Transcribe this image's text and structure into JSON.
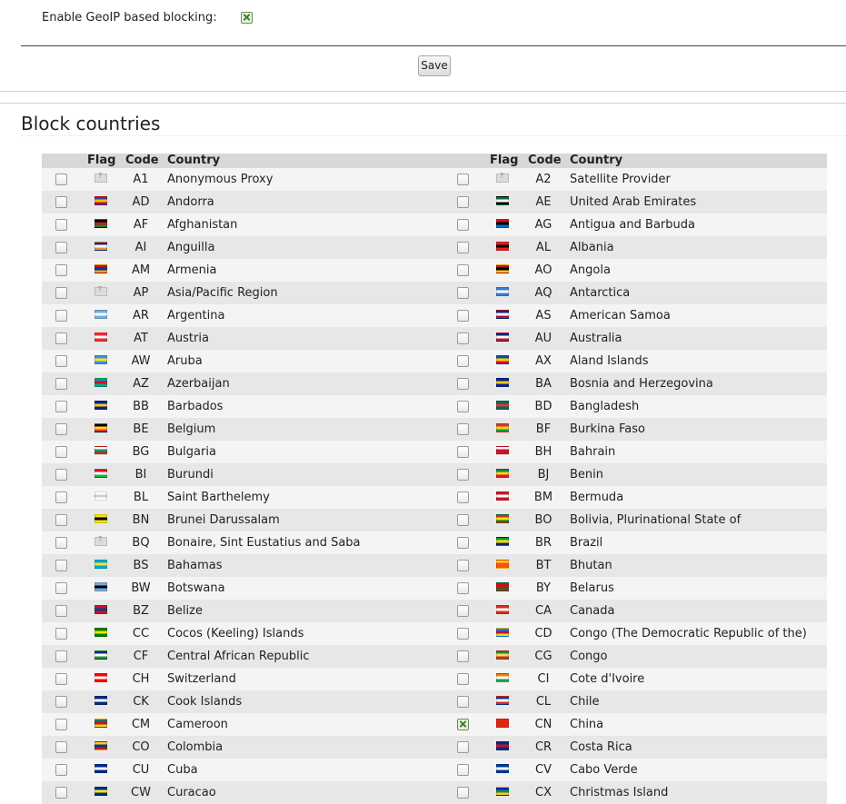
{
  "settings": {
    "geoip_label": "Enable GeoIP based blocking:",
    "geoip_checked": true,
    "save_label": "Save"
  },
  "section_title": "Block countries",
  "headers": {
    "flag": "Flag",
    "code": "Code",
    "country": "Country"
  },
  "rows": [
    {
      "left": {
        "code": "A1",
        "name": "Anonymous Proxy",
        "flag": [
          "unknown"
        ],
        "checked": false
      },
      "right": {
        "code": "A2",
        "name": "Satellite Provider",
        "flag": [
          "unknown"
        ],
        "checked": false
      }
    },
    {
      "left": {
        "code": "AD",
        "name": "Andorra",
        "flag": [
          "#2c3f9e",
          "#f2c300",
          "#d1001f"
        ],
        "checked": false
      },
      "right": {
        "code": "AE",
        "name": "United Arab Emirates",
        "flag": [
          "#00732f",
          "#ffffff",
          "#000000"
        ],
        "checked": false
      }
    },
    {
      "left": {
        "code": "AF",
        "name": "Afghanistan",
        "flag": [
          "#000000",
          "#b32121",
          "#2a7a2a"
        ],
        "checked": false
      },
      "right": {
        "code": "AG",
        "name": "Antigua and Barbuda",
        "flag": [
          "#ce1126",
          "#000000",
          "#0072c6"
        ],
        "checked": false
      }
    },
    {
      "left": {
        "code": "AI",
        "name": "Anguilla",
        "flag": [
          "#1c2a8c",
          "#ffffff",
          "#ef8d2f"
        ],
        "checked": false
      },
      "right": {
        "code": "AL",
        "name": "Albania",
        "flag": [
          "#e41e20",
          "#000000",
          "#e41e20"
        ],
        "checked": false
      }
    },
    {
      "left": {
        "code": "AM",
        "name": "Armenia",
        "flag": [
          "#d90012",
          "#0033a0",
          "#f2a800"
        ],
        "checked": false
      },
      "right": {
        "code": "AO",
        "name": "Angola",
        "flag": [
          "#cc092f",
          "#000000",
          "#ffcb00"
        ],
        "checked": false
      }
    },
    {
      "left": {
        "code": "AP",
        "name": "Asia/Pacific Region",
        "flag": [
          "unknown"
        ],
        "checked": false
      },
      "right": {
        "code": "AQ",
        "name": "Antarctica",
        "flag": [
          "#3a7dce",
          "#ffffff",
          "#3a7dce"
        ],
        "checked": false
      }
    },
    {
      "left": {
        "code": "AR",
        "name": "Argentina",
        "flag": [
          "#74acdf",
          "#ffffff",
          "#74acdf"
        ],
        "checked": false
      },
      "right": {
        "code": "AS",
        "name": "American Samoa",
        "flag": [
          "#002b7f",
          "#ffffff",
          "#bf0a30"
        ],
        "checked": false
      }
    },
    {
      "left": {
        "code": "AT",
        "name": "Austria",
        "flag": [
          "#ed2939",
          "#ffffff",
          "#ed2939"
        ],
        "checked": false
      },
      "right": {
        "code": "AU",
        "name": "Australia",
        "flag": [
          "#00247d",
          "#ffffff",
          "#cf142b"
        ],
        "checked": false
      }
    },
    {
      "left": {
        "code": "AW",
        "name": "Aruba",
        "flag": [
          "#418fde",
          "#f9e814",
          "#418fde"
        ],
        "checked": false
      },
      "right": {
        "code": "AX",
        "name": "Aland Islands",
        "flag": [
          "#0053a5",
          "#ffce00",
          "#d21034"
        ],
        "checked": false
      }
    },
    {
      "left": {
        "code": "AZ",
        "name": "Azerbaijan",
        "flag": [
          "#0092bc",
          "#e4002b",
          "#00af66"
        ],
        "checked": false
      },
      "right": {
        "code": "BA",
        "name": "Bosnia and Herzegovina",
        "flag": [
          "#002395",
          "#fecb00",
          "#002395"
        ],
        "checked": false
      }
    },
    {
      "left": {
        "code": "BB",
        "name": "Barbados",
        "flag": [
          "#00267f",
          "#ffc726",
          "#00267f"
        ],
        "checked": false
      },
      "right": {
        "code": "BD",
        "name": "Bangladesh",
        "flag": [
          "#006a4e",
          "#f42a41",
          "#006a4e"
        ],
        "checked": false
      }
    },
    {
      "left": {
        "code": "BE",
        "name": "Belgium",
        "flag": [
          "#000000",
          "#fdda24",
          "#ef3340"
        ],
        "checked": false
      },
      "right": {
        "code": "BF",
        "name": "Burkina Faso",
        "flag": [
          "#ef2b2d",
          "#fcd116",
          "#009e49"
        ],
        "checked": false
      }
    },
    {
      "left": {
        "code": "BG",
        "name": "Bulgaria",
        "flag": [
          "#ffffff",
          "#00966e",
          "#d62612"
        ],
        "checked": false
      },
      "right": {
        "code": "BH",
        "name": "Bahrain",
        "flag": [
          "#ffffff",
          "#ce1126",
          "#ce1126"
        ],
        "checked": false
      }
    },
    {
      "left": {
        "code": "BI",
        "name": "Burundi",
        "flag": [
          "#ce1126",
          "#ffffff",
          "#1eb53a"
        ],
        "checked": false
      },
      "right": {
        "code": "BJ",
        "name": "Benin",
        "flag": [
          "#008751",
          "#fcd116",
          "#e8112d"
        ],
        "checked": false
      }
    },
    {
      "left": {
        "code": "BL",
        "name": "Saint Barthelemy",
        "flag": [
          "#ffffff",
          "#cfcfcf",
          "#ffffff"
        ],
        "checked": false
      },
      "right": {
        "code": "BM",
        "name": "Bermuda",
        "flag": [
          "#cf142b",
          "#ffffff",
          "#cf142b"
        ],
        "checked": false
      }
    },
    {
      "left": {
        "code": "BN",
        "name": "Brunei Darussalam",
        "flag": [
          "#f7e017",
          "#000000",
          "#f7e017"
        ],
        "checked": false
      },
      "right": {
        "code": "BO",
        "name": "Bolivia, Plurinational State of",
        "flag": [
          "#d52b1e",
          "#f9e300",
          "#007934"
        ],
        "checked": false
      }
    },
    {
      "left": {
        "code": "BQ",
        "name": "Bonaire, Sint Eustatius and Saba",
        "flag": [
          "unknown"
        ],
        "checked": false
      },
      "right": {
        "code": "BR",
        "name": "Brazil",
        "flag": [
          "#009c3b",
          "#ffdf00",
          "#002776"
        ],
        "checked": false
      }
    },
    {
      "left": {
        "code": "BS",
        "name": "Bahamas",
        "flag": [
          "#00abc9",
          "#fae042",
          "#00abc9"
        ],
        "checked": false
      },
      "right": {
        "code": "BT",
        "name": "Bhutan",
        "flag": [
          "#ffd520",
          "#ff4e12",
          "#ff4e12"
        ],
        "checked": false
      }
    },
    {
      "left": {
        "code": "BW",
        "name": "Botswana",
        "flag": [
          "#75aadb",
          "#000000",
          "#75aadb"
        ],
        "checked": false
      },
      "right": {
        "code": "BY",
        "name": "Belarus",
        "flag": [
          "#cf101a",
          "#cf101a",
          "#007d2c"
        ],
        "checked": false
      }
    },
    {
      "left": {
        "code": "BZ",
        "name": "Belize",
        "flag": [
          "#ce1126",
          "#003f87",
          "#ce1126"
        ],
        "checked": false
      },
      "right": {
        "code": "CA",
        "name": "Canada",
        "flag": [
          "#d52b1e",
          "#ffffff",
          "#d52b1e"
        ],
        "checked": false
      }
    },
    {
      "left": {
        "code": "CC",
        "name": "Cocos (Keeling) Islands",
        "flag": [
          "#008000",
          "#ffe000",
          "#008000"
        ],
        "checked": false
      },
      "right": {
        "code": "CD",
        "name": "Congo (The Democratic Republic of the)",
        "flag": [
          "#007fff",
          "#ce1021",
          "#f7d618"
        ],
        "checked": false
      }
    },
    {
      "left": {
        "code": "CF",
        "name": "Central African Republic",
        "flag": [
          "#003082",
          "#ffffff",
          "#289728"
        ],
        "checked": false
      },
      "right": {
        "code": "CG",
        "name": "Congo",
        "flag": [
          "#009543",
          "#fbde4a",
          "#dc241f"
        ],
        "checked": false
      }
    },
    {
      "left": {
        "code": "CH",
        "name": "Switzerland",
        "flag": [
          "#ff0000",
          "#ffffff",
          "#ff0000"
        ],
        "checked": false
      },
      "right": {
        "code": "CI",
        "name": "Cote d'Ivoire",
        "flag": [
          "#f77f00",
          "#ffffff",
          "#009e60"
        ],
        "checked": false
      }
    },
    {
      "left": {
        "code": "CK",
        "name": "Cook Islands",
        "flag": [
          "#002b7f",
          "#ffffff",
          "#002b7f"
        ],
        "checked": false
      },
      "right": {
        "code": "CL",
        "name": "Chile",
        "flag": [
          "#0039a6",
          "#ffffff",
          "#d52b1e"
        ],
        "checked": false
      }
    },
    {
      "left": {
        "code": "CM",
        "name": "Cameroon",
        "flag": [
          "#007a5e",
          "#ce1126",
          "#fcd116"
        ],
        "checked": false
      },
      "right": {
        "code": "CN",
        "name": "China",
        "flag": [
          "#de2910",
          "#de2910",
          "#de2910"
        ],
        "checked": true
      }
    },
    {
      "left": {
        "code": "CO",
        "name": "Colombia",
        "flag": [
          "#fcd116",
          "#003893",
          "#ce1126"
        ],
        "checked": false
      },
      "right": {
        "code": "CR",
        "name": "Costa Rica",
        "flag": [
          "#002b7f",
          "#ce1126",
          "#002b7f"
        ],
        "checked": false
      }
    },
    {
      "left": {
        "code": "CU",
        "name": "Cuba",
        "flag": [
          "#002a8f",
          "#ffffff",
          "#002a8f"
        ],
        "checked": false
      },
      "right": {
        "code": "CV",
        "name": "Cabo Verde",
        "flag": [
          "#003893",
          "#ffffff",
          "#003893"
        ],
        "checked": false
      }
    },
    {
      "left": {
        "code": "CW",
        "name": "Curacao",
        "flag": [
          "#002b7f",
          "#f9e814",
          "#002b7f"
        ],
        "checked": false
      },
      "right": {
        "code": "CX",
        "name": "Christmas Island",
        "flag": [
          "#0021ad",
          "#1c8a42",
          "#ffc639"
        ],
        "checked": false
      }
    }
  ]
}
